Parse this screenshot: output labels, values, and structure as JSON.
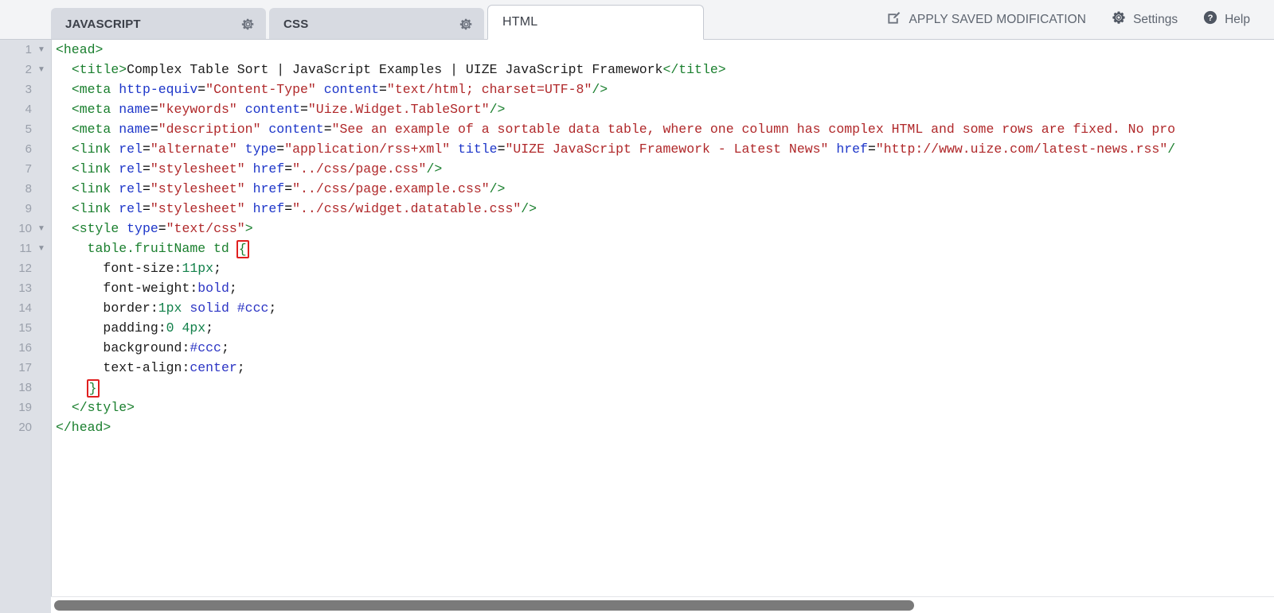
{
  "tabs": [
    {
      "label": "JAVASCRIPT",
      "active": false,
      "gear": "gear-icon"
    },
    {
      "label": "CSS",
      "active": false,
      "gear": "gear-icon"
    },
    {
      "label": "HTML",
      "active": true,
      "gear": null
    }
  ],
  "header": {
    "apply_label": "APPLY SAVED MODIFICATION",
    "apply_icon": "edit-square-icon",
    "settings_label": "Settings",
    "settings_icon": "gear-icon",
    "help_label": "Help",
    "help_icon": "help-circle-icon"
  },
  "editor": {
    "language": "HTML",
    "line_count": 20,
    "fold_lines": [
      1,
      2,
      10,
      11
    ],
    "highlighted_braces": [
      "line11-open-brace",
      "line18-close-brace"
    ],
    "line_numbers": [
      "1",
      "2",
      "3",
      "4",
      "5",
      "6",
      "7",
      "8",
      "9",
      "10",
      "11",
      "12",
      "13",
      "14",
      "15",
      "16",
      "17",
      "18",
      "19",
      "20"
    ],
    "lines": [
      {
        "n": 1,
        "text": "<head>"
      },
      {
        "n": 2,
        "text": "  <title>Complex Table Sort | JavaScript Examples | UIZE JavaScript Framework</title>"
      },
      {
        "n": 3,
        "text": "  <meta http-equiv=\"Content-Type\" content=\"text/html; charset=UTF-8\"/>"
      },
      {
        "n": 4,
        "text": "  <meta name=\"keywords\" content=\"Uize.Widget.TableSort\"/>"
      },
      {
        "n": 5,
        "text": "  <meta name=\"description\" content=\"See an example of a sortable data table, where one column has complex HTML and some rows are fixed. No pro"
      },
      {
        "n": 6,
        "text": "  <link rel=\"alternate\" type=\"application/rss+xml\" title=\"UIZE JavaScript Framework - Latest News\" href=\"http://www.uize.com/latest-news.rss\"/"
      },
      {
        "n": 7,
        "text": "  <link rel=\"stylesheet\" href=\"../css/page.css\"/>"
      },
      {
        "n": 8,
        "text": "  <link rel=\"stylesheet\" href=\"../css/page.example.css\"/>"
      },
      {
        "n": 9,
        "text": "  <link rel=\"stylesheet\" href=\"../css/widget.datatable.css\"/>"
      },
      {
        "n": 10,
        "text": "  <style type=\"text/css\">"
      },
      {
        "n": 11,
        "text": "    table.fruitName td {"
      },
      {
        "n": 12,
        "text": "      font-size:11px;"
      },
      {
        "n": 13,
        "text": "      font-weight:bold;"
      },
      {
        "n": 14,
        "text": "      border:1px solid #ccc;"
      },
      {
        "n": 15,
        "text": "      padding:0 4px;"
      },
      {
        "n": 16,
        "text": "      background:#ccc;"
      },
      {
        "n": 17,
        "text": "      text-align:center;"
      },
      {
        "n": 18,
        "text": "    }"
      },
      {
        "n": 19,
        "text": "  </style>"
      },
      {
        "n": 20,
        "text": "</head>"
      }
    ]
  },
  "scrollbar": {
    "orientation": "horizontal",
    "thumb_position_percent": 0
  },
  "colors": {
    "tab_inactive_bg": "#d7dae1",
    "tab_active_bg": "#ffffff",
    "topbar_bg": "#f3f4f6",
    "gutter_bg": "#dde0e6",
    "tag": "#1a7f2e",
    "attribute": "#1d36c9",
    "string": "#b0282a",
    "number": "#12804a",
    "keyword": "#2b34c4",
    "brace_highlight": "#e02020",
    "scrollbar_thumb": "#7a7a7a"
  }
}
